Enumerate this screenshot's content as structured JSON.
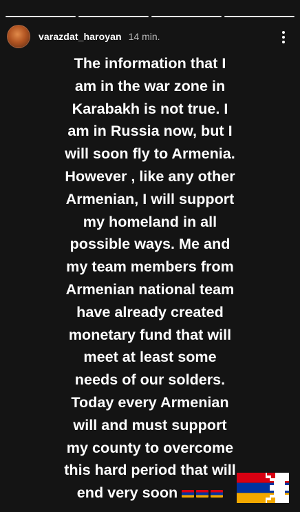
{
  "story": {
    "progress_segments": 4,
    "username": "varazdat_haroyan",
    "timestamp": "14 min.",
    "icons": {
      "more": "vertical-ellipsis-icon",
      "avatar": "profile-avatar"
    },
    "text": "The information that I\nam in the war zone in\nKarabakh is not true.  I\nam in Russia now, but I\nwill soon fly to Armenia.\nHowever , like any other\nArmenian, I will support\nmy  homeland in all\npossible ways. Me and\nmy team members from\nArmenian national team\nhave  already created\nmonetary fund  that will\nmeet at least some\nneeds of our solders.\nToday every Armenian\nwill  and must support\nmy county to overcome\nthis hard period that will\nend very soon",
    "emoji_flags": [
      "armenia-flag-emoji",
      "armenia-flag-emoji",
      "armenia-flag-emoji"
    ],
    "sticker": "armenia-artsakh-flag-sticker",
    "colors": {
      "background": "#141414",
      "text": "#ffffff",
      "flag_red": "#d90012",
      "flag_blue": "#0033a0",
      "flag_orange": "#f2a800"
    }
  }
}
